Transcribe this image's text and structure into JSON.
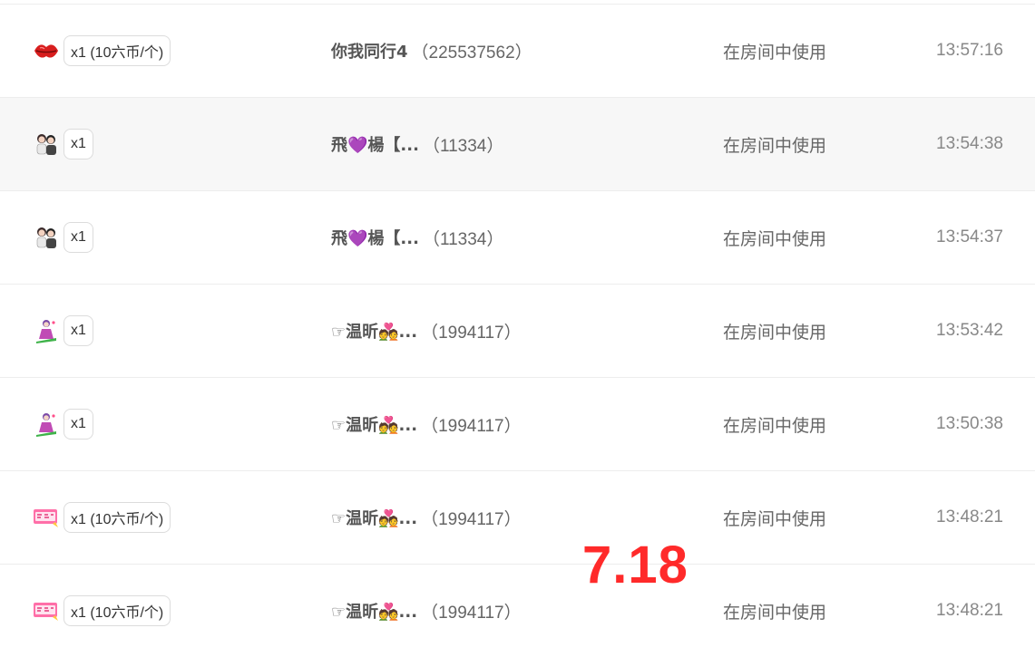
{
  "rows": [
    {
      "gift_icon": "lips-icon",
      "qty": "x1 (10六币/个)",
      "name": "你我同行4",
      "uid": "（225537562）",
      "action": "在房间中使用",
      "time": "13:57:16",
      "highlight": false
    },
    {
      "gift_icon": "couple-icon",
      "qty": "x1",
      "name": "飛💜楊【...",
      "uid": "（11334）",
      "action": "在房间中使用",
      "time": "13:54:38",
      "highlight": true
    },
    {
      "gift_icon": "couple-icon",
      "qty": "x1",
      "name": "飛💜楊【...",
      "uid": "（11334）",
      "action": "在房间中使用",
      "time": "13:54:37",
      "highlight": false
    },
    {
      "gift_icon": "dancer-icon",
      "qty": "x1",
      "name": "☞温昕💑...",
      "uid": "（1994117）",
      "action": "在房间中使用",
      "time": "13:53:42",
      "highlight": false
    },
    {
      "gift_icon": "dancer-icon",
      "qty": "x1",
      "name": "☞温昕💑...",
      "uid": "（1994117）",
      "action": "在房间中使用",
      "time": "13:50:38",
      "highlight": false
    },
    {
      "gift_icon": "banner-icon",
      "qty": "x1 (10六币/个)",
      "name": "☞温昕💑...",
      "uid": "（1994117）",
      "action": "在房间中使用",
      "time": "13:48:21",
      "highlight": false
    },
    {
      "gift_icon": "banner-icon",
      "qty": "x1 (10六币/个)",
      "name": "☞温昕💑...",
      "uid": "（1994117）",
      "action": "在房间中使用",
      "time": "13:48:21",
      "highlight": false
    }
  ],
  "watermark": "7.18",
  "colors": {
    "watermark": "#ff2a2a",
    "row_highlight": "#f7f7f7",
    "badge_border": "#dcdcdc"
  }
}
